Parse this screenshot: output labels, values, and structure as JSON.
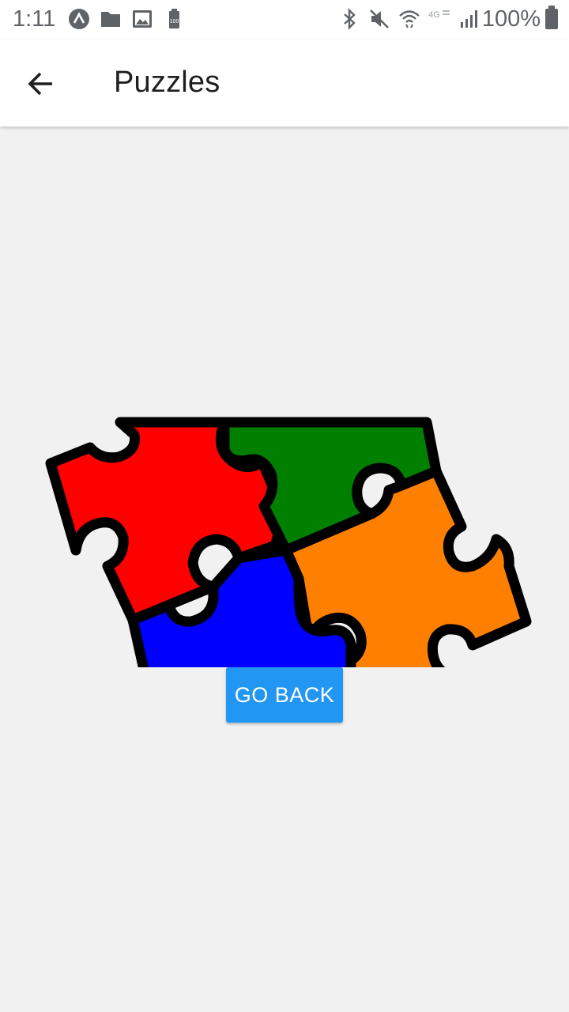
{
  "status_bar": {
    "time": "1:11",
    "battery_percent": "100%",
    "left_icons": [
      "expo-icon",
      "folder-icon",
      "image-icon",
      "battery-saver-icon"
    ],
    "right_icons": [
      "bluetooth-icon",
      "mute-icon",
      "wifi-icon",
      "lte-icon",
      "signal-icon"
    ],
    "battery_badge": "100"
  },
  "app_bar": {
    "title": "Puzzles",
    "back_icon": "arrow-back-icon"
  },
  "content": {
    "image": "jigsaw-puzzle-image",
    "piece_colors": {
      "red": "#ff0000",
      "green": "#007f00",
      "blue": "#0000ff",
      "orange": "#ff8000",
      "outline": "#000000"
    },
    "button_label": "GO BACK",
    "button_color": "#2196f3"
  }
}
